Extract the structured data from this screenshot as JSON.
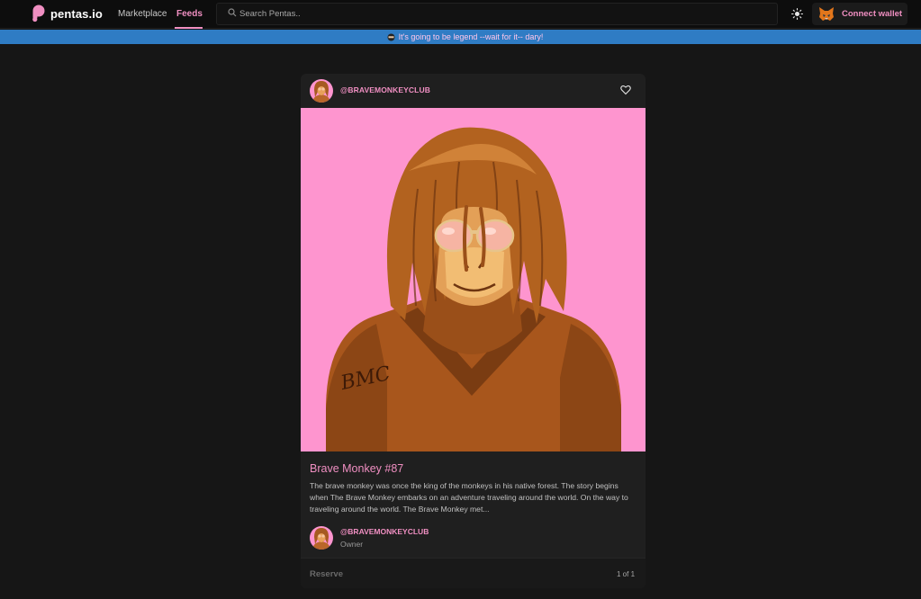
{
  "header": {
    "brand": "pentas.io",
    "nav": {
      "marketplace": "Marketplace",
      "feeds": "Feeds",
      "active": "Feeds"
    },
    "search": {
      "placeholder": "Search Pentas..",
      "value": ""
    },
    "theme_icon": "sun-icon",
    "wallet_label": "Connect wallet",
    "wallet_icon": "metamask-fox-icon"
  },
  "banner": {
    "emoji_icon": "ninja-emoji-icon",
    "text": "It's going to be legend --wait for it-- dary!",
    "background": "#2f7cc4"
  },
  "post": {
    "author": "@BRAVEMONKEYCLUB",
    "like_icon": "heart-outline-icon",
    "image_background": "#fe95cf",
    "title": "Brave Monkey #87",
    "description": "The brave monkey was once the king of the monkeys in his native forest. The story begins when The Brave Monkey embarks on an adventure traveling around the world. On the way to traveling around the world. The Brave Monkey met...",
    "owner": {
      "handle": "@BRAVEMONKEYCLUB",
      "role": "Owner"
    },
    "action_label": "Reserve",
    "edition": "1 of 1"
  },
  "colors": {
    "accent": "#f08fc2",
    "page_background": "#161616",
    "card_background": "#1f1f1f"
  }
}
